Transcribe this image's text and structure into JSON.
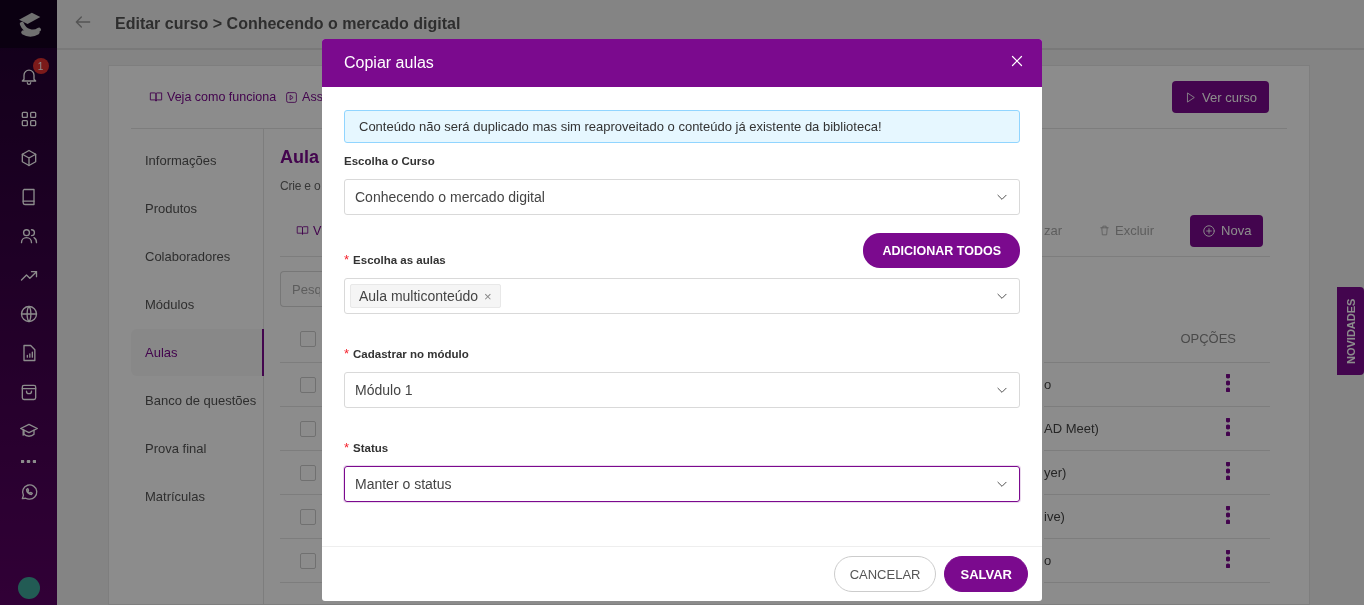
{
  "header": {
    "title": "Editar curso > Conhecendo o mercado digital"
  },
  "sidebar": {
    "notification_count": "1"
  },
  "novidades_tab": {
    "label": "NOVIDADES"
  },
  "course_card": {
    "links": [
      {
        "label": "Veja como funciona"
      },
      {
        "label": "Ass"
      }
    ],
    "view_button": "Ver curso",
    "nav": [
      {
        "label": "Informações",
        "selected": false
      },
      {
        "label": "Produtos",
        "selected": false
      },
      {
        "label": "Colaboradores",
        "selected": false
      },
      {
        "label": "Módulos",
        "selected": false
      },
      {
        "label": "Aulas",
        "selected": true
      },
      {
        "label": "Banco de questões",
        "selected": false
      },
      {
        "label": "Prova final",
        "selected": false
      },
      {
        "label": "Matrículas",
        "selected": false
      }
    ],
    "lessons": {
      "title": "Aula",
      "description": "Crie e o",
      "toolbar_link": "V",
      "search_placeholder": "Pesq",
      "actions": [
        {
          "label": "zar",
          "disabled": true
        },
        {
          "label": "Excluir",
          "disabled": true
        }
      ],
      "new_button": "Nova",
      "header_checked": false,
      "options_header": "OPÇÕES",
      "rows": [
        {
          "title": "o",
          "checked": false
        },
        {
          "title": "AD Meet)",
          "checked": false
        },
        {
          "title": "yer)",
          "checked": false
        },
        {
          "title": "ive)",
          "checked": false
        },
        {
          "title": "o",
          "checked": false
        }
      ]
    }
  },
  "modal": {
    "title": "Copiar aulas",
    "alert": "Conteúdo não será duplicado mas sim reaproveitado o conteúdo já existente da biblioteca!",
    "required_mark": "*",
    "fields": [
      {
        "label": "Escolha o Curso",
        "required": false,
        "kind": "select",
        "value": "Conhecendo o mercado digital",
        "focused": false
      },
      {
        "label": "Escolha as aulas",
        "required": true,
        "kind": "multiselect",
        "tags": [
          {
            "label": "Aula multiconteúdo",
            "remove": "×"
          }
        ],
        "action": "ADICIONAR TODOS",
        "focused": false
      },
      {
        "label": "Cadastrar no módulo",
        "required": true,
        "kind": "select",
        "value": "Módulo 1",
        "focused": false
      },
      {
        "label": "Status",
        "required": true,
        "kind": "select",
        "value": "Manter o status",
        "focused": true
      }
    ],
    "buttons": [
      {
        "label": "CANCELAR",
        "kind": "secondary"
      },
      {
        "label": "SALVAR",
        "kind": "primary"
      }
    ]
  }
}
